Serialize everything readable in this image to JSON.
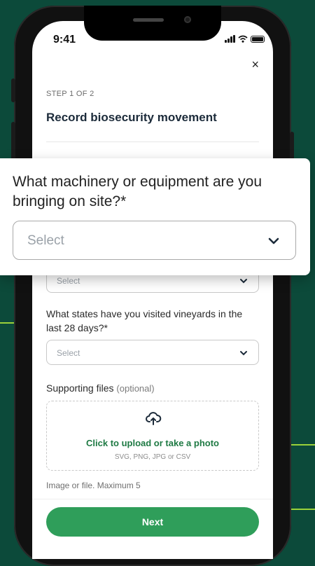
{
  "status_bar": {
    "time": "9:41",
    "icons": [
      "signal-icon",
      "wifi-icon",
      "battery-icon"
    ]
  },
  "header": {
    "close_label": "×",
    "step": "STEP 1 OF 2",
    "title": "Record biosecurity movement"
  },
  "overlay": {
    "question": "What machinery or equipment are you bringing on site?*",
    "select_placeholder": "Select"
  },
  "behind_select": {
    "placeholder": "Select"
  },
  "states_question": {
    "label": "What states have you visited vineyards in the last 28 days?*",
    "select_placeholder": "Select"
  },
  "files": {
    "label": "Supporting files",
    "optional": "(optional)",
    "upload_text": "Click to upload or take a photo",
    "upload_types": "SVG, PNG, JPG or CSV",
    "hint": "Image or file. Maximum 5"
  },
  "footer": {
    "next_label": "Next"
  },
  "colors": {
    "background": "#0c4a3a",
    "accent_line": "#9bd13a",
    "primary_button": "#2f9e5a",
    "link_green": "#1f7a44"
  }
}
